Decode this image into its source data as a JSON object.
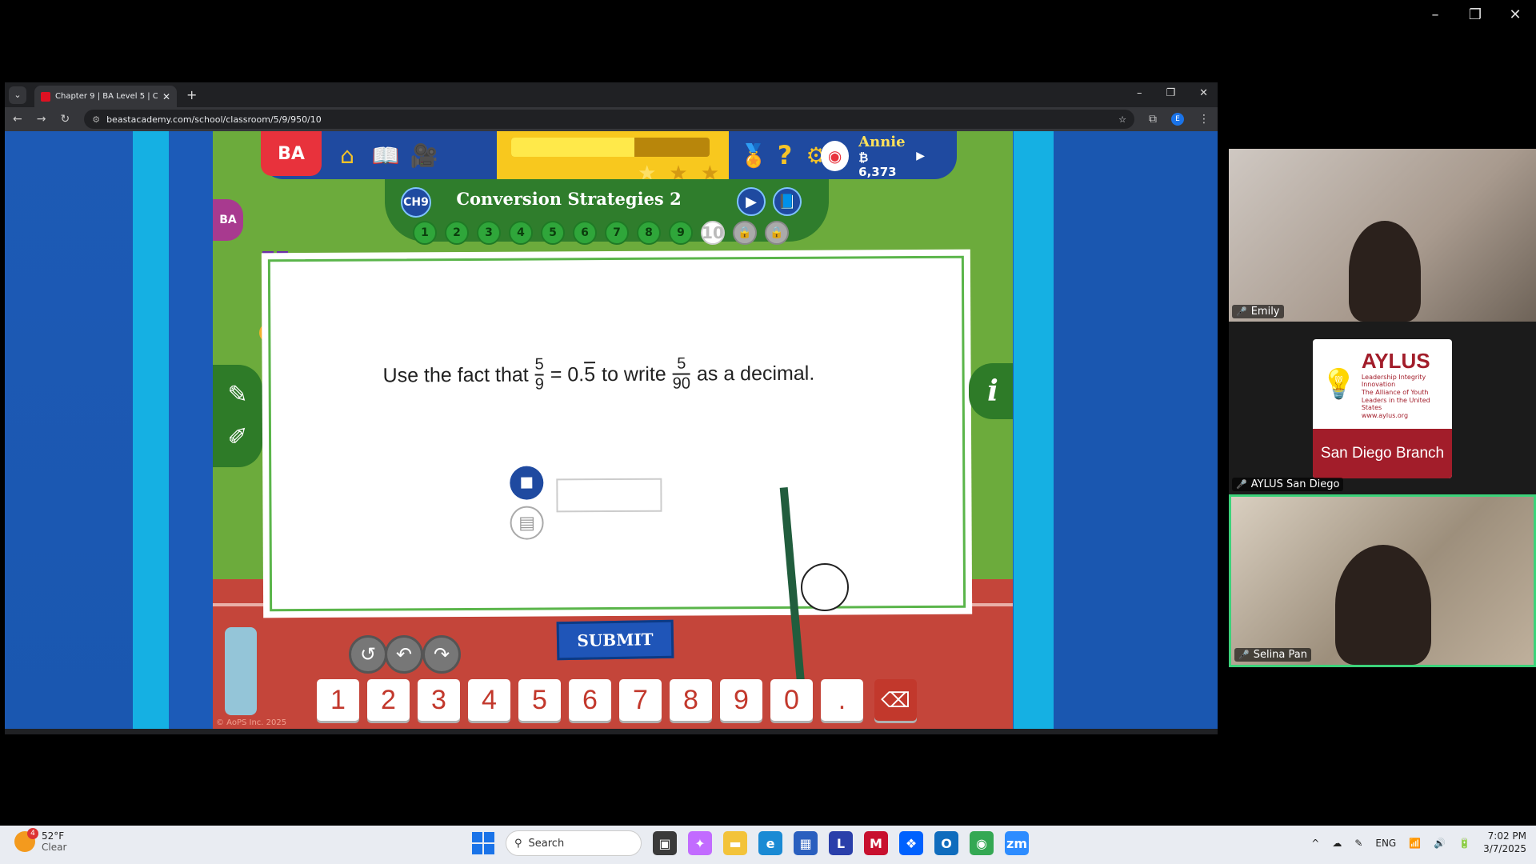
{
  "screen": {
    "controls": [
      "–",
      "❐",
      "✕"
    ]
  },
  "browser": {
    "tab_title": "Chapter 9 | BA Level 5 | Classro",
    "url": "beastacademy.com/school/classroom/5/9/950/10",
    "avatar_letter": "E"
  },
  "game": {
    "logo": "BA",
    "progress_fraction": 0.62,
    "stars": [
      "★",
      "★",
      "★"
    ],
    "user_name": "Annie",
    "user_coins": "₿ 6,373",
    "chapter_badge": "CH9",
    "lesson_title": "Conversion Strategies 2",
    "problems": [
      "1",
      "2",
      "3",
      "4",
      "5",
      "6",
      "7",
      "8",
      "9",
      "10"
    ],
    "current_problem": "10",
    "bao_tab": "BA",
    "info_tab": "i",
    "question": {
      "part1": "Use the fact that",
      "frac1_num": "5",
      "frac1_den": "9",
      "equals": "= 0.",
      "repeating_digit": "5",
      "part2": "to write",
      "frac2_num": "5",
      "frac2_den": "90",
      "part3": "as a decimal."
    },
    "answer_value": "",
    "submit_label": "SUBMIT",
    "keypad": [
      "1",
      "2",
      "3",
      "4",
      "5",
      "6",
      "7",
      "8",
      "9",
      "0",
      "."
    ],
    "backspace": "⌫",
    "copyright": "© AoPS Inc. 2025"
  },
  "zoom": {
    "participants": [
      {
        "name": "Emily"
      },
      {
        "name": "AYLUS San Diego"
      },
      {
        "name": "Selina Pan"
      }
    ],
    "aylus": {
      "name": "AYLUS",
      "tagline": "Leadership Integrity Innovation",
      "full_name": "The Alliance of Youth Leaders in the United States",
      "website": "www.aylus.org",
      "branch": "San Diego Branch"
    }
  },
  "taskbar": {
    "weather_badge": "4",
    "temperature": "52°F",
    "condition": "Clear",
    "search_placeholder": "Search",
    "language": "ENG",
    "time": "7:02 PM",
    "date": "3/7/2025"
  }
}
